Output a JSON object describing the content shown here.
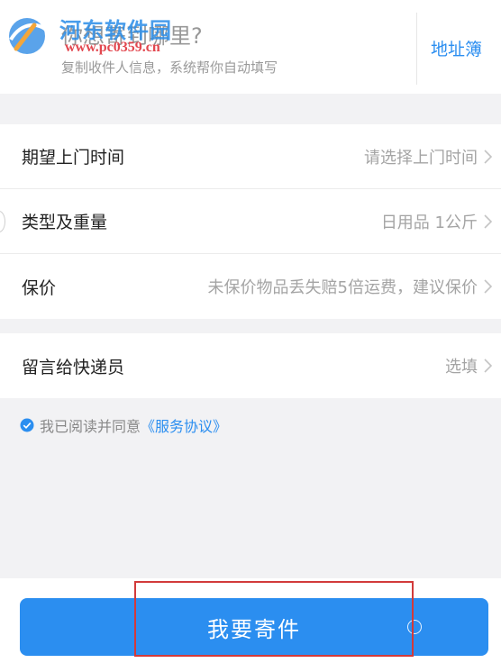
{
  "watermark": {
    "name": "河东软件园",
    "url": "www.pc0359.cn"
  },
  "sender": {
    "title": "你想寄到哪里?",
    "subtitle": "复制收件人信息，系统帮你自动填写",
    "address_book": "地址簿"
  },
  "form": {
    "rows": [
      {
        "label": "期望上门时间",
        "value": "请选择上门时间"
      },
      {
        "label": "类型及重量",
        "value": "日用品 1公斤"
      },
      {
        "label": "保价",
        "value": "未保价物品丢失赔5倍运费，建议保价"
      }
    ],
    "note": {
      "label": "留言给快递员",
      "value": "选填"
    }
  },
  "agreement": {
    "text": "我已阅读并同意",
    "link": "《服务协议》"
  },
  "submit": {
    "label": "我要寄件"
  },
  "colors": {
    "accent": "#2b8ef0",
    "highlight": "#d23a3a",
    "background": "#f2f2f4"
  }
}
